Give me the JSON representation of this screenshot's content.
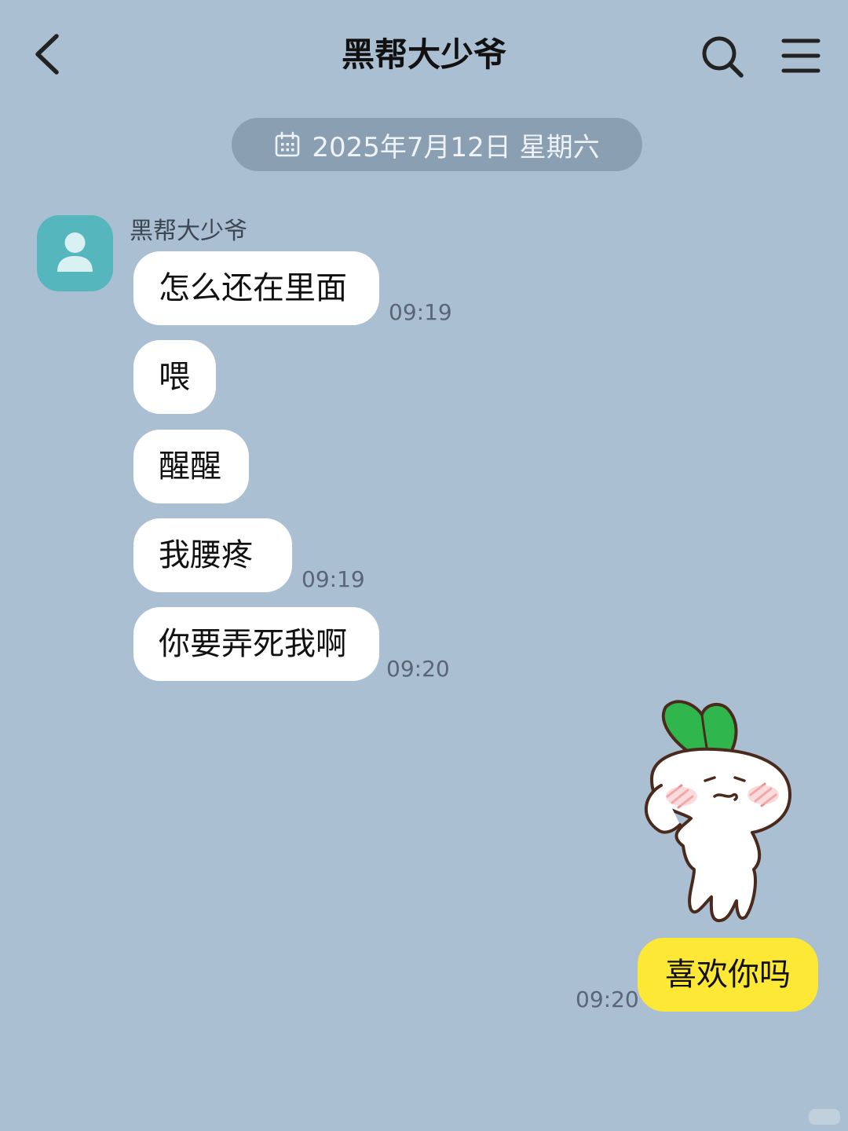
{
  "header": {
    "title": "黑帮大少爷",
    "back_icon": "chevron-left-icon",
    "search_icon": "search-icon",
    "menu_icon": "hamburger-menu-icon"
  },
  "date_divider": {
    "icon": "calendar-icon",
    "text": "2025年7月12日  星期六"
  },
  "contact": {
    "name": "黑帮大少爷",
    "avatar_icon": "default-user-icon",
    "avatar_color": "#55b7bd"
  },
  "messages": [
    {
      "text": "怎么还在里面",
      "time": "09:19"
    },
    {
      "text": "喂",
      "time": ""
    },
    {
      "text": "醒醒",
      "time": ""
    },
    {
      "text": "我腰疼",
      "time": "09:19"
    },
    {
      "text": "你要弄死我啊",
      "time": "09:20"
    }
  ],
  "sent": {
    "sticker": "radish-character-sticker",
    "text": "喜欢你吗",
    "time": "09:20",
    "bubble_color": "#fde835"
  },
  "colors": {
    "background": "#abbfd3",
    "date_pill": "#8b9fb2",
    "incoming_bubble": "#ffffff"
  }
}
